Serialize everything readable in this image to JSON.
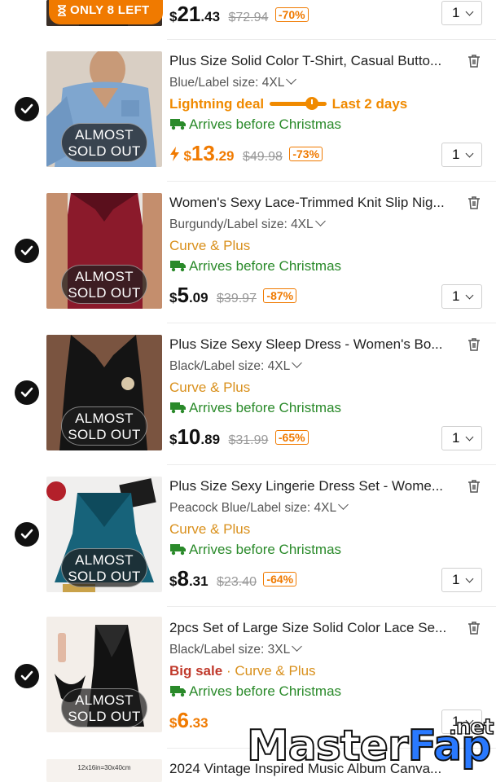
{
  "top_item": {
    "badge": "ONLY 8 LEFT",
    "price": {
      "currency": "$",
      "whole": "21",
      "cents": ".43",
      "original": "$72.94",
      "discount": "-70%"
    },
    "qty": "1"
  },
  "items": [
    {
      "title": "Plus Size Solid Color T-Shirt, Casual Butto...",
      "variant": "Blue/Label size: 4XL",
      "deal_label": "Lightning deal",
      "deal_time": "Last 2 days",
      "arrival": "Arrives before Christmas",
      "price": {
        "currency": "$",
        "whole": "13",
        "cents": ".29",
        "original": "$49.98",
        "discount": "-73%"
      },
      "qty": "1",
      "sold_out_line1": "ALMOST",
      "sold_out_line2": "SOLD OUT"
    },
    {
      "title": "Women's Sexy Lace-Trimmed Knit Slip Nig...",
      "variant": "Burgundy/Label size: 4XL",
      "tag": "Curve & Plus",
      "arrival": "Arrives before Christmas",
      "price": {
        "currency": "$",
        "whole": "5",
        "cents": ".09",
        "original": "$39.97",
        "discount": "-87%"
      },
      "qty": "1",
      "sold_out_line1": "ALMOST",
      "sold_out_line2": "SOLD OUT"
    },
    {
      "title": "Plus Size Sexy Sleep Dress - Women's Bo...",
      "variant": "Black/Label size: 4XL",
      "tag": "Curve & Plus",
      "arrival": "Arrives before Christmas",
      "price": {
        "currency": "$",
        "whole": "10",
        "cents": ".89",
        "original": "$31.99",
        "discount": "-65%"
      },
      "qty": "1",
      "sold_out_line1": "ALMOST",
      "sold_out_line2": "SOLD OUT"
    },
    {
      "title": "Plus Size Sexy Lingerie Dress Set - Wome...",
      "variant": "Peacock Blue/Label size: 4XL",
      "tag": "Curve & Plus",
      "arrival": "Arrives before Christmas",
      "price": {
        "currency": "$",
        "whole": "8",
        "cents": ".31",
        "original": "$23.40",
        "discount": "-64%"
      },
      "qty": "1",
      "sold_out_line1": "ALMOST",
      "sold_out_line2": "SOLD OUT"
    },
    {
      "title": "2pcs Set of Large Size Solid Color Lace Se...",
      "variant": "Black/Label size: 3XL",
      "sale_label": "Big sale",
      "separator": "·",
      "tag": "Curve & Plus",
      "arrival": "Arrives before Christmas",
      "price": {
        "currency": "$",
        "whole": "6",
        "cents": ".33"
      },
      "qty": "1",
      "sold_out_line1": "ALMOST",
      "sold_out_line2": "SOLD OUT"
    }
  ],
  "bottom_item": {
    "title": "2024 Vintage Inspired Music Album Canva...",
    "thumb_text": "12x16in=30x40cm"
  },
  "watermark": {
    "part1": "Master",
    "part2": "Fap",
    "suffix": ".net"
  },
  "colors": {
    "accent_orange": "#f07a00",
    "curve_tag": "#d9901c",
    "arrival_green": "#2a8a2a",
    "big_sale_red": "#c0392b",
    "check_black": "#111111"
  }
}
